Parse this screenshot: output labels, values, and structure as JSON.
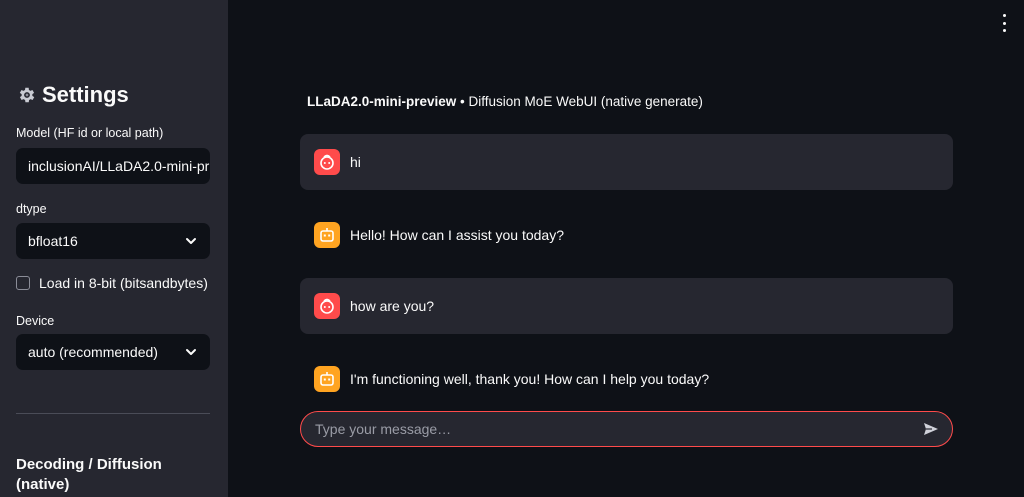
{
  "sidebar": {
    "title": "Settings",
    "model_label": "Model (HF id or local path)",
    "model_value": "inclusionAI/LLaDA2.0-mini-pr",
    "dtype_label": "dtype",
    "dtype_value": "bfloat16",
    "load8bit_label": "Load in 8-bit (bitsandbytes)",
    "load8bit_checked": false,
    "device_label": "Device",
    "device_value": "auto (recommended)",
    "section_title": "Decoding / Diffusion (native)"
  },
  "header": {
    "model_name": "LLaDA2.0-mini-preview",
    "separator": " • ",
    "subtitle": "Diffusion MoE WebUI (native generate)"
  },
  "messages": [
    {
      "role": "user",
      "text": "hi"
    },
    {
      "role": "assistant",
      "text": "Hello! How can I assist you today?"
    },
    {
      "role": "user",
      "text": "how are you?"
    },
    {
      "role": "assistant",
      "text": "I'm functioning well, thank you! How can I help you today?"
    }
  ],
  "chat_input": {
    "placeholder": "Type your message…"
  },
  "icons": {
    "settings": "gear-icon",
    "user_avatar": "user-avatar-icon",
    "bot_avatar": "robot-avatar-icon",
    "send": "send-icon",
    "menu": "kebab-menu-icon"
  },
  "colors": {
    "accent": "#ff4b4b",
    "bot": "#ffa421",
    "sidebar_bg": "#262730",
    "main_bg": "#0e1117"
  }
}
